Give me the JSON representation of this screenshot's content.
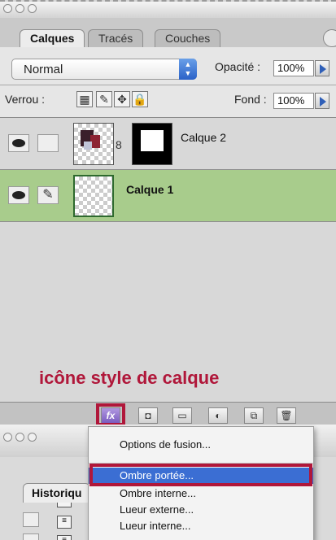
{
  "layers_palette": {
    "tabs": [
      "Calques",
      "Tracés",
      "Couches"
    ],
    "blend_mode": "Normal",
    "opacity_label": "Opacité :",
    "opacity_value": "100%",
    "lock_label": "Verrou :",
    "fill_label": "Fond :",
    "fill_value": "100%",
    "layers": [
      {
        "name": "Calque 2",
        "visible": true,
        "selected": false,
        "has_mask": true
      },
      {
        "name": "Calque 1",
        "visible": true,
        "selected": true,
        "has_mask": false
      }
    ]
  },
  "annotation": {
    "text": "icône style de calque",
    "color": "#b0173a"
  },
  "history_palette": {
    "tab": "Historiqu"
  },
  "layer_style_menu": {
    "items": [
      "Options de fusion...",
      "Ombre portée...",
      "Ombre interne...",
      "Lueur externe...",
      "Lueur interne..."
    ],
    "highlighted": "Ombre portée...",
    "highlight_color": "#3b6ed3"
  },
  "icons": [
    "eye-icon",
    "brush-icon",
    "chain-link-icon",
    "fx-icon",
    "mask-icon",
    "folder-icon",
    "adjustment-icon",
    "new-layer-icon",
    "trash-icon",
    "lock-icon",
    "move-icon"
  ]
}
